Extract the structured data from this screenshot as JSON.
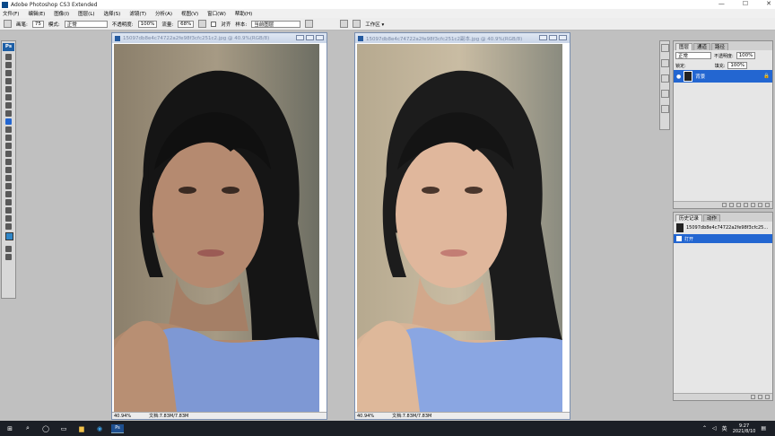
{
  "window": {
    "title": "Adobe Photoshop CS3 Extended",
    "controls": [
      "—",
      "☐",
      "✕"
    ]
  },
  "menu": [
    "文件(F)",
    "编辑(E)",
    "图像(I)",
    "图层(L)",
    "选择(S)",
    "滤镜(T)",
    "分析(A)",
    "视图(V)",
    "窗口(W)",
    "帮助(H)"
  ],
  "options": {
    "brush_label": "画笔:",
    "brush_size": "75",
    "mode_label": "模式:",
    "mode_value": "正常",
    "opacity_label": "不透明度:",
    "opacity_value": "100%",
    "flow_label": "流量:",
    "flow_value": "68%",
    "align_label": "对齐",
    "sample_label": "样本:",
    "sample_value": "当前图层",
    "workspace": "工作区 ▾"
  },
  "doc_left": {
    "title": "15097db8e4c74722a2fe98f3cfc251c2.jpg @ 40.9%(RGB/8)",
    "zoom": "40.94%",
    "doc_size": "文档:7.83M/7.83M"
  },
  "doc_right": {
    "title": "15097db8e4c74722a2fe98f3cfc251c2副本.jpg @ 40.9%(RGB/8)",
    "zoom": "40.94%",
    "doc_size": "文档:7.83M/7.83M"
  },
  "layers_panel": {
    "tabs": [
      "图层",
      "通道",
      "路径"
    ],
    "blend_mode": "正常",
    "opacity_label": "不透明度:",
    "opacity_value": "100%",
    "lock_label": "锁定:",
    "fill_label": "填充:",
    "fill_value": "100%",
    "layer_name": "背景"
  },
  "history_panel": {
    "tabs": [
      "历史记录",
      "动作"
    ],
    "snapshot": "15097db8e4c74722a2fe98f3cfc25...",
    "step": "打开"
  },
  "taskbar": {
    "lang": "英",
    "time": "9:27",
    "date": "2021/8/10"
  },
  "colors": {
    "accent": "#2366d1",
    "foreground": "#2f86c8",
    "taskbar": "#1b1f26"
  }
}
